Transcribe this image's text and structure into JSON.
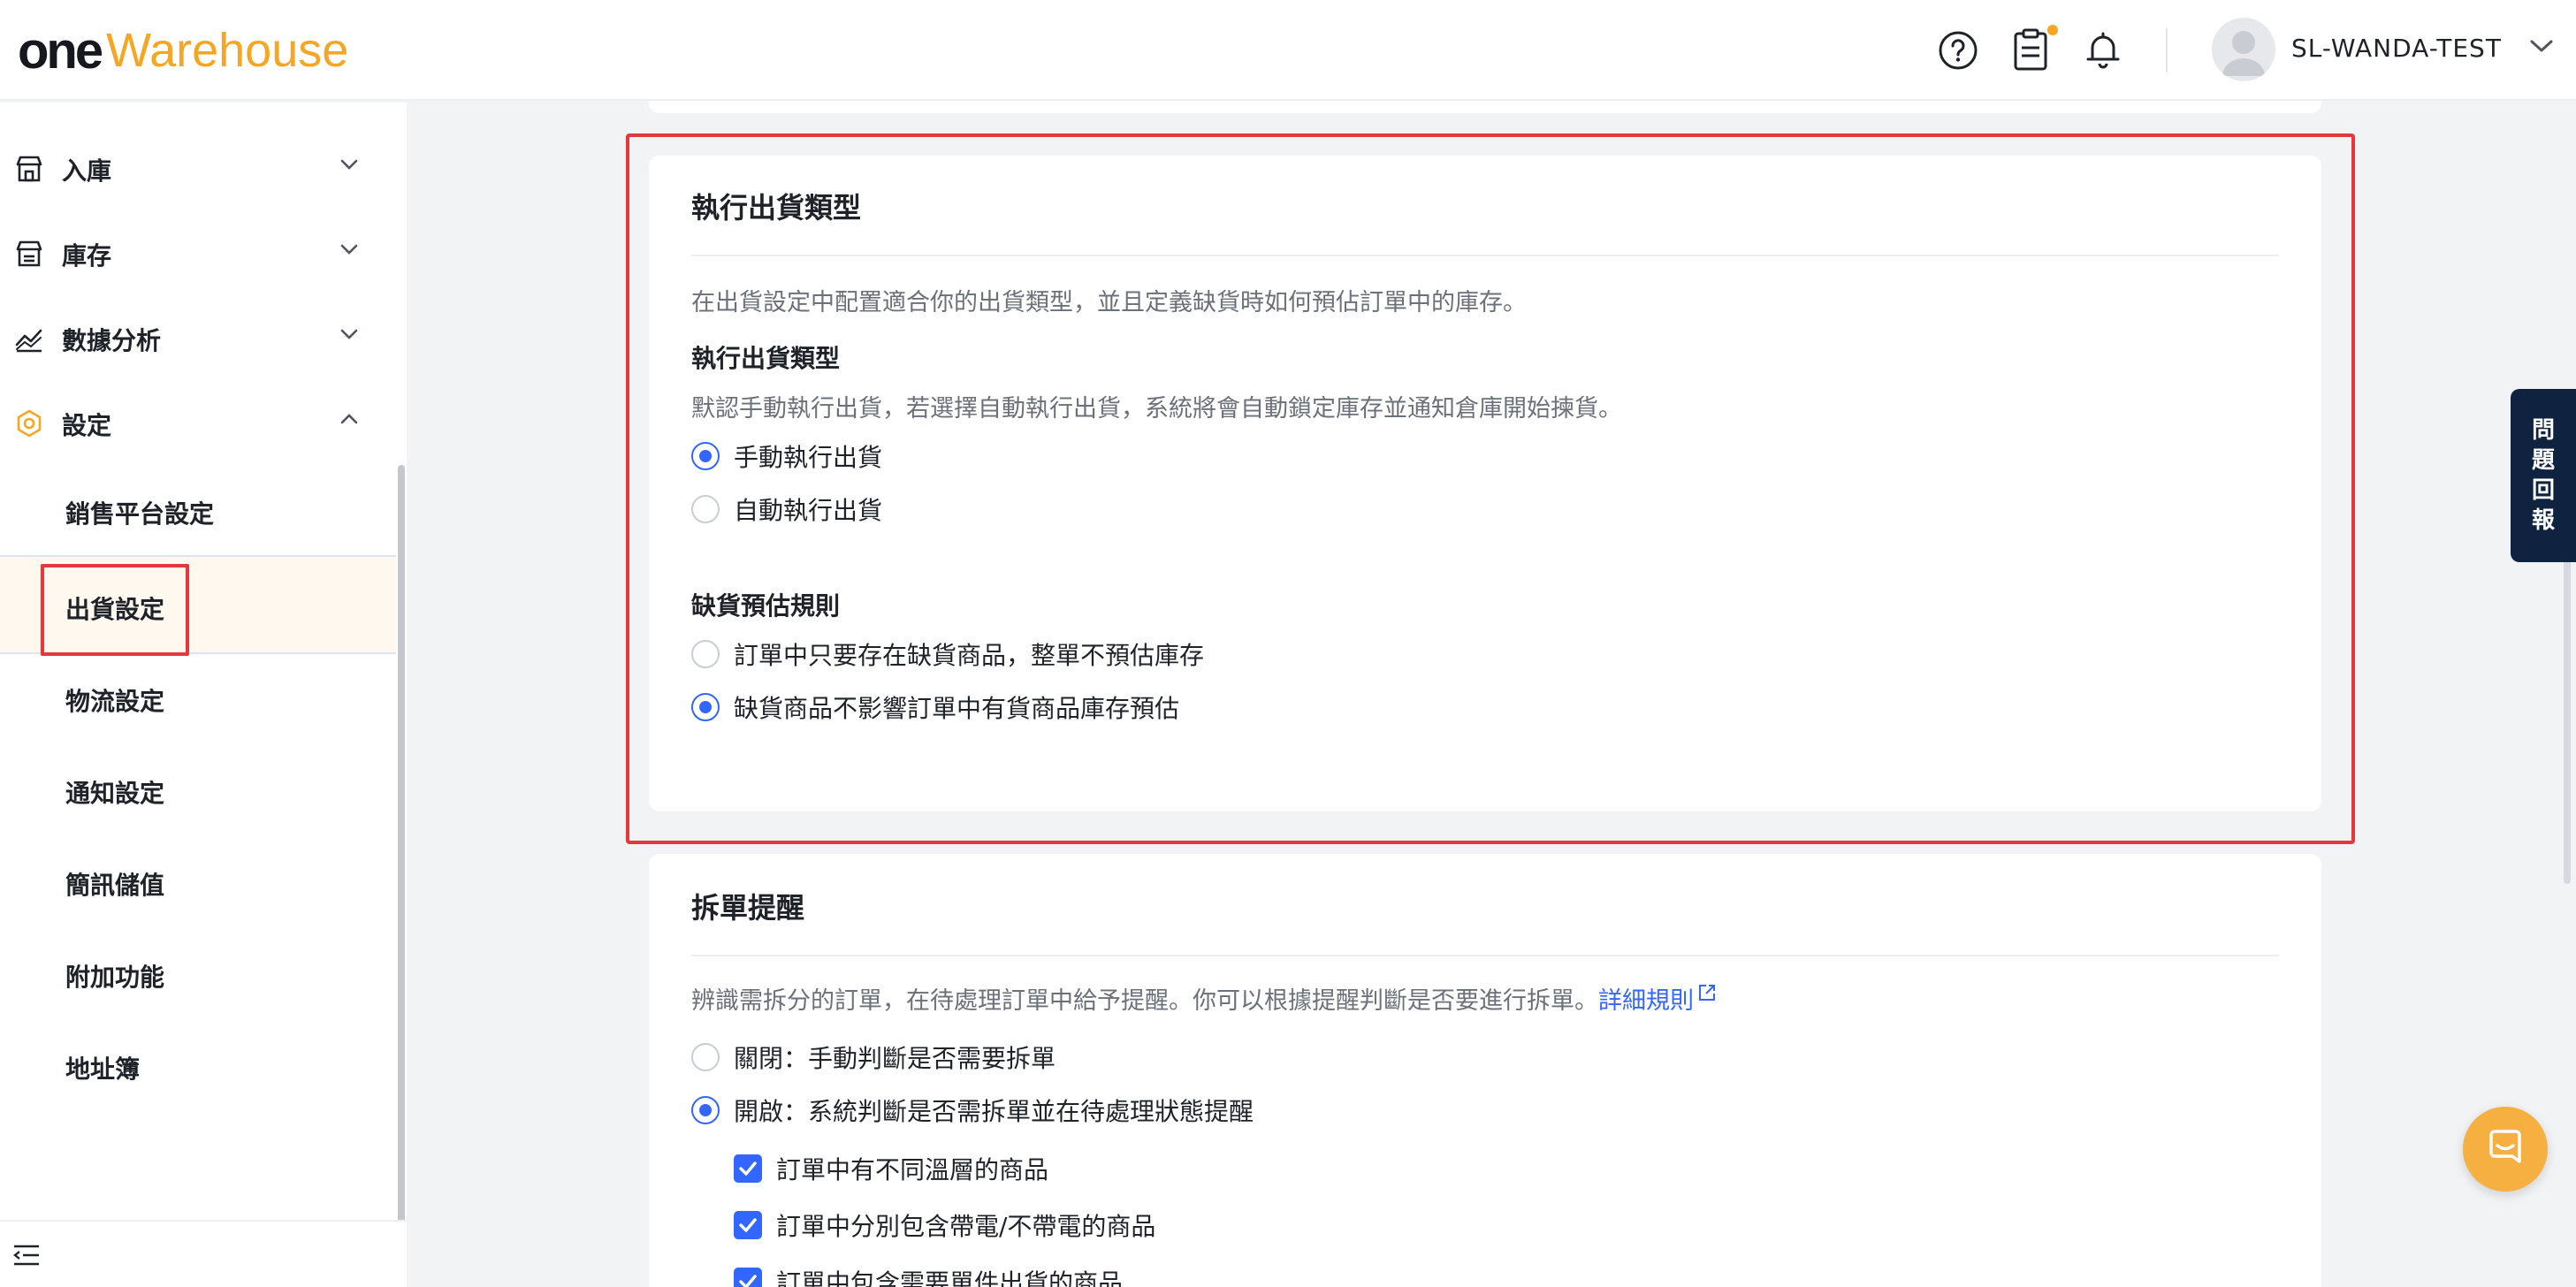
{
  "header": {
    "logo_one": "one",
    "logo_warehouse": "Warehouse",
    "username": "SL-WANDA-TEST",
    "icons": [
      "help-circle-icon",
      "clipboard-icon",
      "bell-icon",
      "chevron-down-icon"
    ],
    "notification_dot_color": "#f5a623"
  },
  "sidebar": {
    "groups": [
      {
        "label": "入庫",
        "icon": "store-icon"
      },
      {
        "label": "庫存",
        "icon": "warehouse-icon"
      },
      {
        "label": "數據分析",
        "icon": "chart-line-icon"
      },
      {
        "label": "設定",
        "icon": "hexagon-settings-icon"
      }
    ],
    "sub_items": [
      {
        "label": "銷售平台設定"
      },
      {
        "label": "出貨設定",
        "active": true
      },
      {
        "label": "物流設定"
      },
      {
        "label": "通知設定"
      },
      {
        "label": "簡訊儲值"
      },
      {
        "label": "附加功能"
      },
      {
        "label": "地址簿"
      }
    ]
  },
  "shipment_type": {
    "title": "執行出貨類型",
    "description": "在出貨設定中配置適合你的出貨類型，並且定義缺貨時如何預佔訂單中的庫存。",
    "execution": {
      "title": "執行出貨類型",
      "description": "默認手動執行出貨，若選擇自動執行出貨，系統將會自動鎖定庫存並通知倉庫開始揀貨。",
      "options": [
        {
          "label": "手動執行出貨",
          "selected": true
        },
        {
          "label": "自動執行出貨",
          "selected": false
        }
      ]
    },
    "stockout": {
      "title": "缺貨預估規則",
      "options": [
        {
          "label": "訂單中只要存在缺貨商品，整單不預估庫存",
          "selected": false
        },
        {
          "label": "缺貨商品不影響訂單中有貨商品庫存預估",
          "selected": true
        }
      ]
    }
  },
  "split_reminder": {
    "title": "拆單提醒",
    "description": "辨識需拆分的訂單，在待處理訂單中給予提醒。你可以根據提醒判斷是否要進行拆單。",
    "link": "詳細規則",
    "options": [
      {
        "label": "關閉：手動判斷是否需要拆單",
        "selected": false
      },
      {
        "label": "開啟：系統判斷是否需拆單並在待處理狀態提醒",
        "selected": true
      }
    ],
    "checkboxes": [
      {
        "label": "訂單中有不同溫層的商品",
        "checked": true
      },
      {
        "label": "訂單中分別包含帶電/不帶電的商品",
        "checked": true
      },
      {
        "label": "訂單中包含需要單件出貨的商品",
        "checked": true
      }
    ]
  },
  "feedback": {
    "chars": [
      "問",
      "題",
      "回",
      "報"
    ]
  },
  "colors": {
    "accent": "#3366ff",
    "highlight": "#e4393c",
    "brand_orange": "#f5a623",
    "feedback_bg": "#0f2340",
    "chat_bg": "#f5b041"
  }
}
